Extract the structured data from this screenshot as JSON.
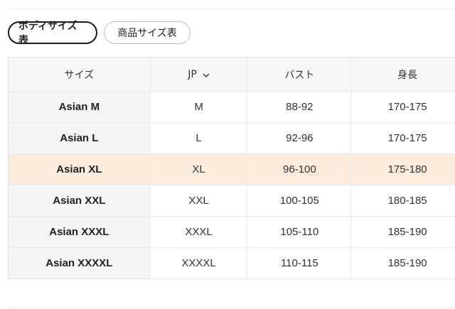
{
  "tabs": [
    {
      "label": "ボディサイズ表",
      "active": true
    },
    {
      "label": "商品サイズ表",
      "active": false
    }
  ],
  "table": {
    "headers": [
      "サイズ",
      "JP",
      "バスト",
      "身長"
    ],
    "rows": [
      [
        "Asian M",
        "M",
        "88-92",
        "170-175"
      ],
      [
        "Asian L",
        "L",
        "92-96",
        "170-175"
      ],
      [
        "Asian XL",
        "XL",
        "96-100",
        "175-180"
      ],
      [
        "Asian XXL",
        "XXL",
        "100-105",
        "180-185"
      ],
      [
        "Asian XXXL",
        "XXXL",
        "105-110",
        "185-190"
      ],
      [
        "Asian XXXXL",
        "XXXXL",
        "110-115",
        "185-190"
      ]
    ],
    "highlight_row": 2
  },
  "colors": {
    "highlight": "#fdebdc",
    "label_bg": "#f5f5f5",
    "header_bg": "#f7f7f7"
  }
}
